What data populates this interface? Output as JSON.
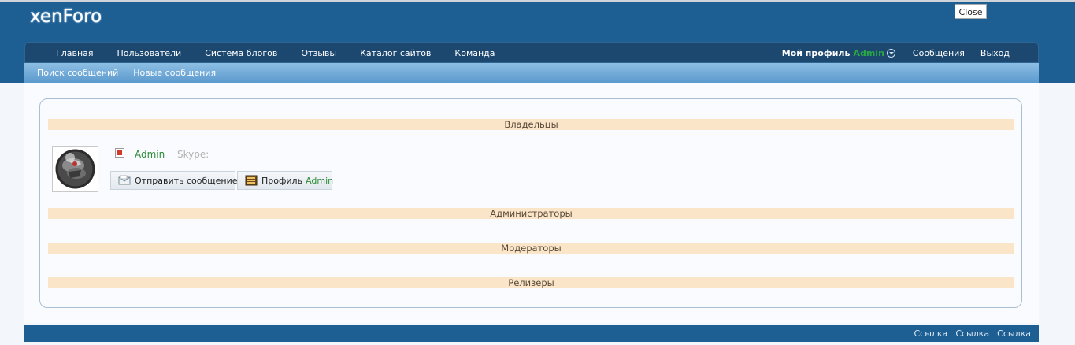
{
  "header": {
    "logo": "xenForo",
    "close_label": "Close"
  },
  "nav": {
    "items": [
      {
        "label": "Главная"
      },
      {
        "label": "Пользователи"
      },
      {
        "label": "Система блогов"
      },
      {
        "label": "Отзывы"
      },
      {
        "label": "Каталог сайтов"
      },
      {
        "label": "Команда"
      }
    ],
    "profile_label": "Мой профиль",
    "profile_user": "Admin",
    "messages_label": "Сообщения",
    "logout_label": "Выход"
  },
  "subnav": {
    "items": [
      {
        "label": "Поиск сообщений"
      },
      {
        "label": "Новые сообщения"
      }
    ]
  },
  "groups": [
    {
      "title": "Владельцы"
    },
    {
      "title": "Администраторы"
    },
    {
      "title": "Модераторы"
    },
    {
      "title": "Релизеры"
    }
  ],
  "member": {
    "name": "Admin",
    "skype_label": "Skype:",
    "pm_button": "Отправить сообщение",
    "profile_button": "Профиль",
    "profile_button_user": "Admin"
  },
  "footer": {
    "links": [
      {
        "label": "Ссылка"
      },
      {
        "label": "Ссылка"
      },
      {
        "label": "Ссылка"
      }
    ]
  },
  "colors": {
    "header_blue": "#1d5e93",
    "nav_dark": "#1c4870",
    "group_header_bg": "#fbe5c8",
    "username_green": "#2a8a36"
  }
}
